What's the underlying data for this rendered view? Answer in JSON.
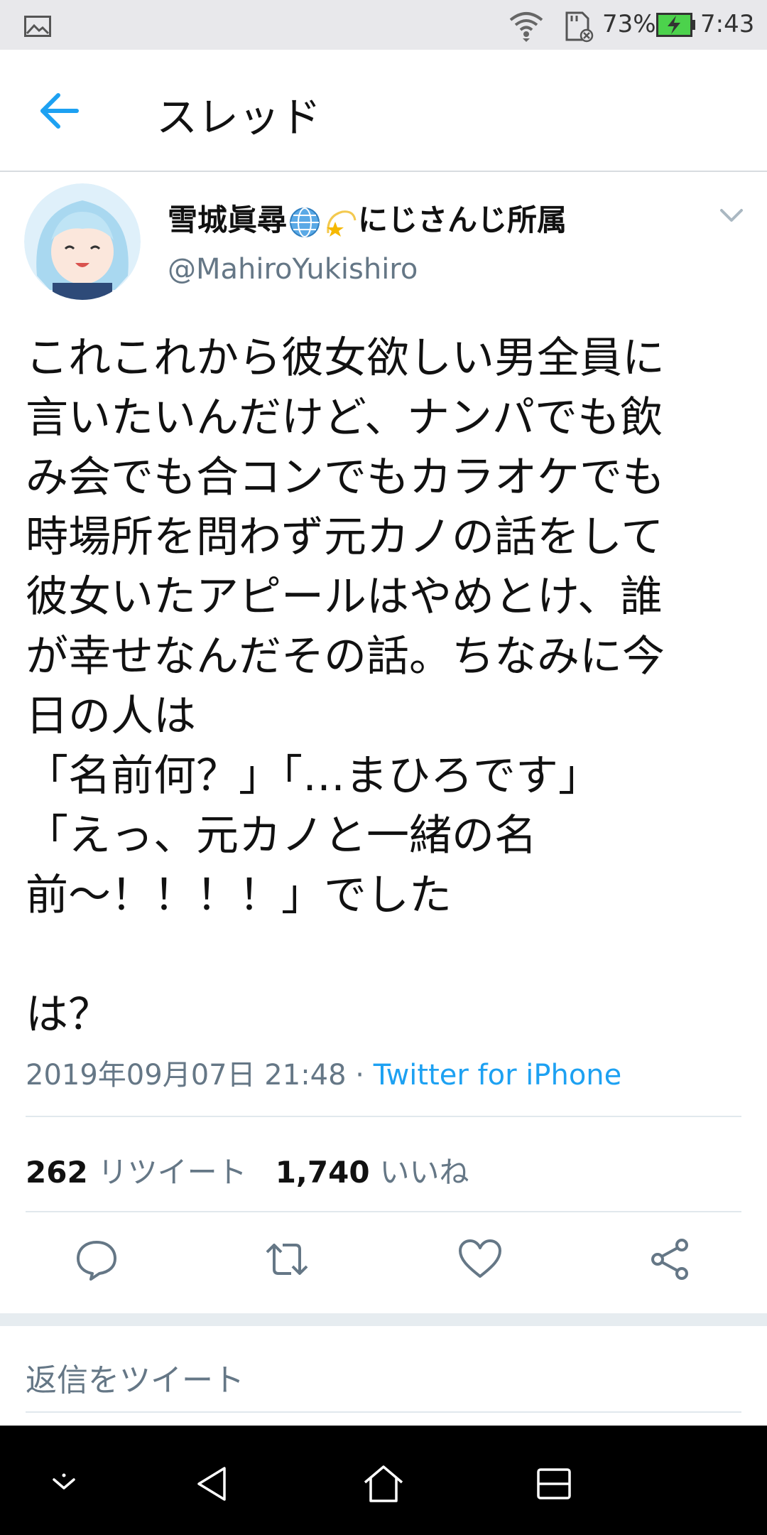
{
  "status_bar": {
    "battery_percent": "73%",
    "time": "7:43",
    "icons": [
      "gallery-icon",
      "wifi-icon",
      "sd-card-icon",
      "battery-charging-icon"
    ]
  },
  "app_bar": {
    "title": "スレッド",
    "back_icon": "arrow-left-icon"
  },
  "tweet": {
    "author": {
      "name_part1": "雪城眞尋",
      "name_part2": "にじさんじ所属",
      "name_emojis": [
        "globe-emoji",
        "dizzy-star-emoji"
      ],
      "handle": "@MahiroYukishiro"
    },
    "text": "これこれから彼女欲しい男全員に\n言いたいんだけど、ナンパでも飲\nみ会でも合コンでもカラオケでも\n時場所を問わず元カノの話をして\n彼女いたアピールはやめとけ、誰\nが幸せなんだその話。ちなみに今\n日の人は\n「名前何？」「…まひろです」\n「えっ、元カノと一緒の名\n前〜！！！！」でした\n\nは？",
    "timestamp": "2019年09月07日 21:48",
    "separator": " · ",
    "source": "Twitter for iPhone",
    "stats": {
      "retweets_count": "262",
      "retweets_label": "リツイート",
      "likes_count": "1,740",
      "likes_label": "いいね"
    },
    "actions": [
      "reply-icon",
      "retweet-icon",
      "like-icon",
      "share-icon"
    ]
  },
  "reply_box": {
    "placeholder": "返信をツイート"
  },
  "nav_bar": {
    "icons": [
      "hide-nav-icon",
      "back-triangle-icon",
      "home-icon",
      "recents-icon"
    ]
  },
  "colors": {
    "accent": "#1da1f2",
    "secondary_text": "#657786",
    "status_bar_bg": "#e8e8eb",
    "nav_bar_bg": "#000000"
  }
}
